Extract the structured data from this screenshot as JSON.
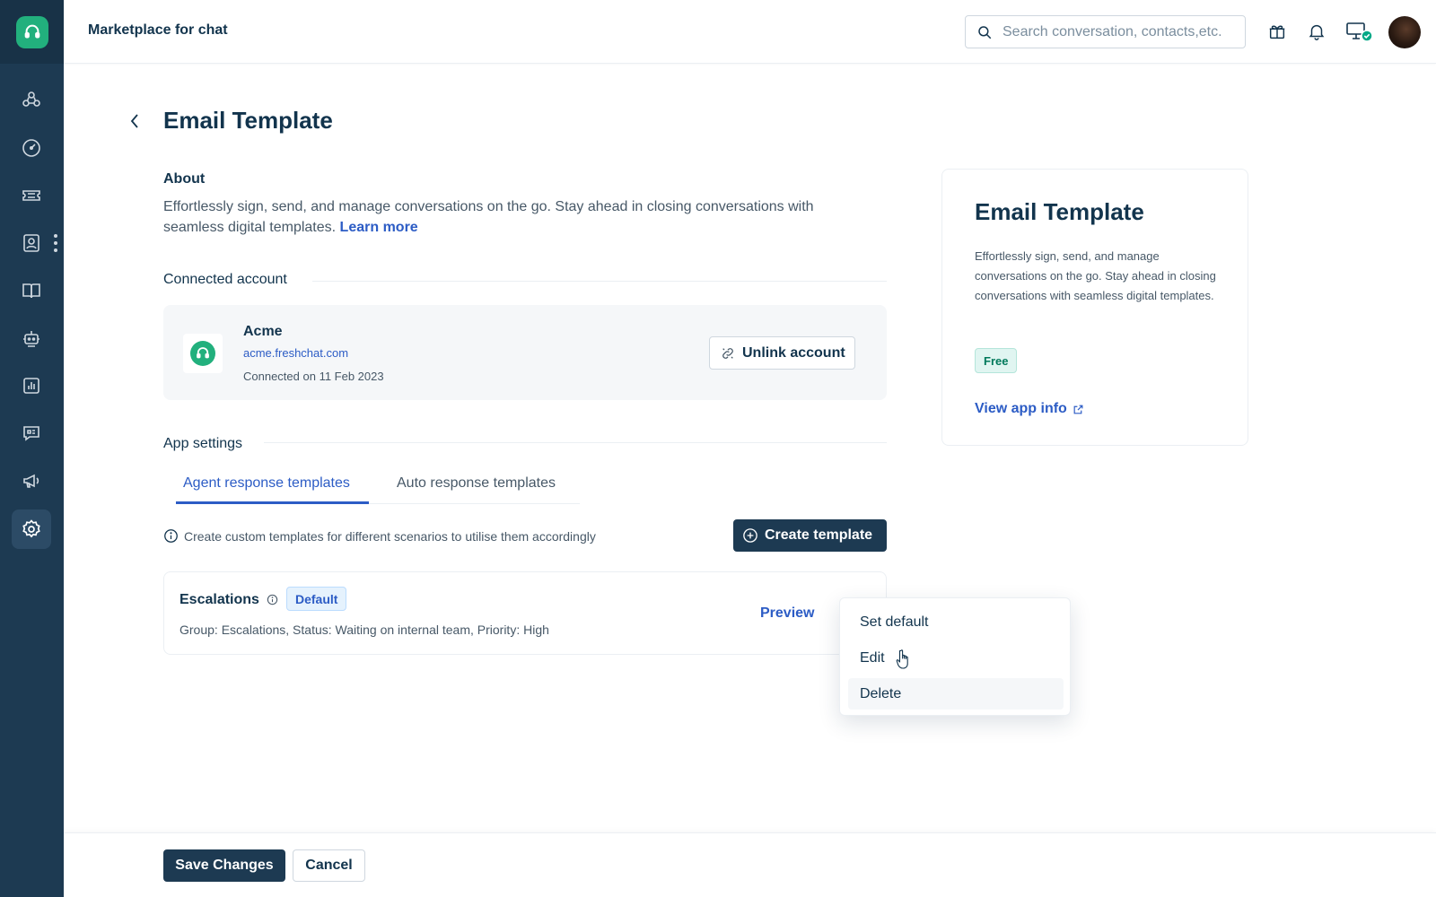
{
  "topbar": {
    "title": "Marketplace for chat",
    "search_placeholder": "Search conversation, contacts,etc."
  },
  "sidebar": {
    "items": [
      {
        "icon": "team-icon"
      },
      {
        "icon": "dashboard-icon"
      },
      {
        "icon": "ticket-icon"
      },
      {
        "icon": "contacts-icon"
      },
      {
        "icon": "knowledge-base-icon"
      },
      {
        "icon": "bot-icon"
      },
      {
        "icon": "reports-icon"
      },
      {
        "icon": "chat-icon"
      },
      {
        "icon": "campaigns-icon"
      },
      {
        "icon": "settings-icon",
        "active": true
      }
    ]
  },
  "page": {
    "title": "Email Template",
    "about_heading": "About",
    "about_text": "Effortlessly sign, send, and manage conversations on the go. Stay ahead in closing conversations with seamless digital templates.",
    "learn_more": "Learn more"
  },
  "connected_account": {
    "heading": "Connected account",
    "name": "Acme",
    "domain": "acme.freshchat.com",
    "connected_on": "Connected on 11 Feb 2023",
    "unlink_label": "Unlink account"
  },
  "app_settings": {
    "heading": "App settings",
    "tabs": [
      {
        "label": "Agent response templates",
        "active": true
      },
      {
        "label": "Auto response templates",
        "active": false
      }
    ],
    "info_text": "Create custom templates for different scenarios to utilise them accordingly",
    "create_label": "Create template",
    "templates": [
      {
        "name": "Escalations",
        "badge": "Default",
        "description": "Group: Escalations, Status: Waiting on internal team, Priority: High",
        "preview_label": "Preview"
      }
    ]
  },
  "menu": {
    "items": [
      "Set default",
      "Edit",
      "Delete"
    ]
  },
  "app_card": {
    "title": "Email Template",
    "description": "Effortlessly sign, send, and manage conversations on the go. Stay ahead in closing conversations with seamless digital templates.",
    "badge": "Free",
    "link": "View app info"
  },
  "footer": {
    "save_label": "Save Changes",
    "cancel_label": "Cancel"
  },
  "colors": {
    "sidebar": "#1d3a52",
    "brand_green": "#22b07d",
    "primary_button": "#1d3a52",
    "link": "#2c5cc5"
  }
}
